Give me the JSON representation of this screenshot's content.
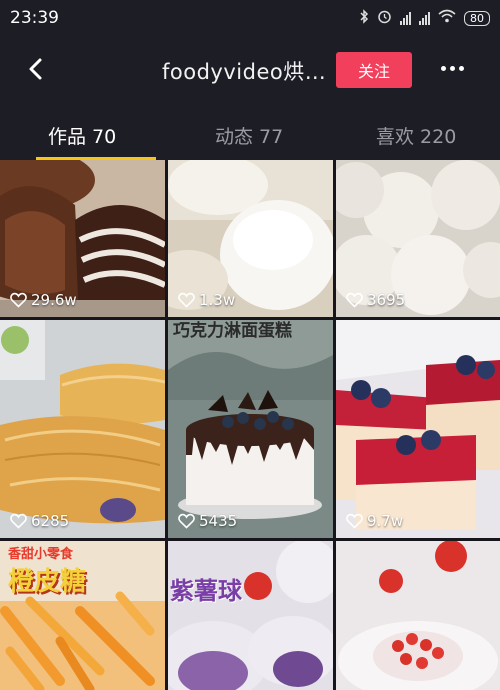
{
  "status": {
    "time": "23:39",
    "battery": "80"
  },
  "nav": {
    "title": "foodyvideo烘…",
    "follow_label": "关注"
  },
  "tabs": [
    {
      "label": "作品 70"
    },
    {
      "label": "动态 77"
    },
    {
      "label": "喜欢 220"
    }
  ],
  "videos": [
    {
      "likes": "29.6w"
    },
    {
      "likes": "1.3w"
    },
    {
      "likes": "3695"
    },
    {
      "likes": "6285"
    },
    {
      "likes": "5435",
      "overlay": "巧克力淋面蛋糕"
    },
    {
      "likes": "9.7w"
    },
    {
      "overlay": "香甜小零食",
      "overlay2": "橙皮糖"
    },
    {
      "overlay": "紫薯球"
    },
    {}
  ],
  "colors": {
    "accent": "#f23f5c",
    "tab_indicator": "#f5c518"
  }
}
